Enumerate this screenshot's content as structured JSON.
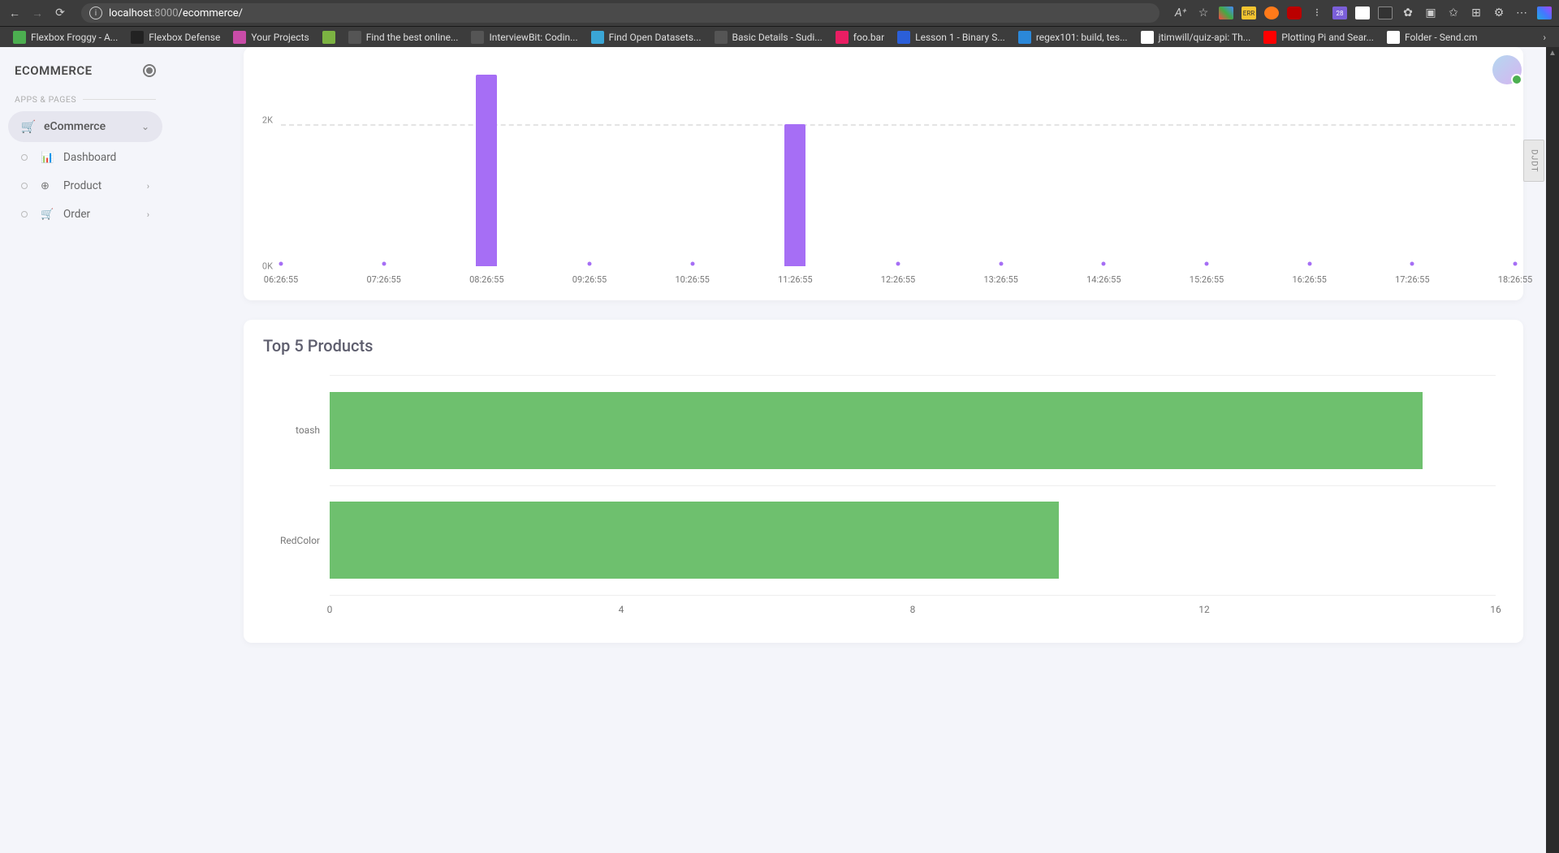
{
  "browser": {
    "url_host": "localhost",
    "url_port": ":8000",
    "url_path": "/ecommerce/"
  },
  "bookmarks": [
    {
      "label": "Flexbox Froggy - A...",
      "color": "#4caf50"
    },
    {
      "label": "Flexbox Defense",
      "color": "#222"
    },
    {
      "label": "Your Projects",
      "color": "#c94ca8"
    },
    {
      "label": "",
      "color": "#7cb342"
    },
    {
      "label": "Find the best online...",
      "color": "#555"
    },
    {
      "label": "InterviewBit: Codin...",
      "color": "#555"
    },
    {
      "label": "Find Open Datasets...",
      "color": "#3aa6d6"
    },
    {
      "label": "Basic Details - Sudi...",
      "color": "#555"
    },
    {
      "label": "foo.bar",
      "color": "#e91e63"
    },
    {
      "label": "Lesson 1 - Binary S...",
      "color": "#2b5fd9"
    },
    {
      "label": "regex101: build, tes...",
      "color": "#2b88d9"
    },
    {
      "label": "jtimwill/quiz-api: Th...",
      "color": "#fff"
    },
    {
      "label": "Plotting Pi and Sear...",
      "color": "#f00"
    },
    {
      "label": "Folder - Send.cm",
      "color": "#fff"
    }
  ],
  "sidebar": {
    "brand": "ECOMMERCE",
    "section": "APPS & PAGES",
    "items": {
      "ecommerce": "eCommerce",
      "dashboard": "Dashboard",
      "product": "Product",
      "order": "Order"
    }
  },
  "chart_data": [
    {
      "type": "bar",
      "title": "",
      "x": [
        "06:26:55",
        "07:26:55",
        "08:26:55",
        "09:26:55",
        "10:26:55",
        "11:26:55",
        "12:26:55",
        "13:26:55",
        "14:26:55",
        "15:26:55",
        "16:26:55",
        "17:26:55",
        "18:26:55"
      ],
      "values": [
        0,
        0,
        2700,
        0,
        0,
        2000,
        0,
        0,
        0,
        0,
        0,
        0,
        0
      ],
      "y_ticks": [
        {
          "v": 0,
          "label": "0K"
        },
        {
          "v": 2000,
          "label": "2K"
        }
      ],
      "ylim": [
        0,
        3000
      ]
    },
    {
      "type": "bar",
      "orientation": "horizontal",
      "title": "Top 5 Products",
      "categories": [
        "toash",
        "RedColor"
      ],
      "values": [
        15,
        10
      ],
      "x_ticks": [
        0,
        4,
        8,
        12,
        16
      ],
      "xlim": [
        0,
        16
      ]
    }
  ],
  "side_tab": "DJDT"
}
